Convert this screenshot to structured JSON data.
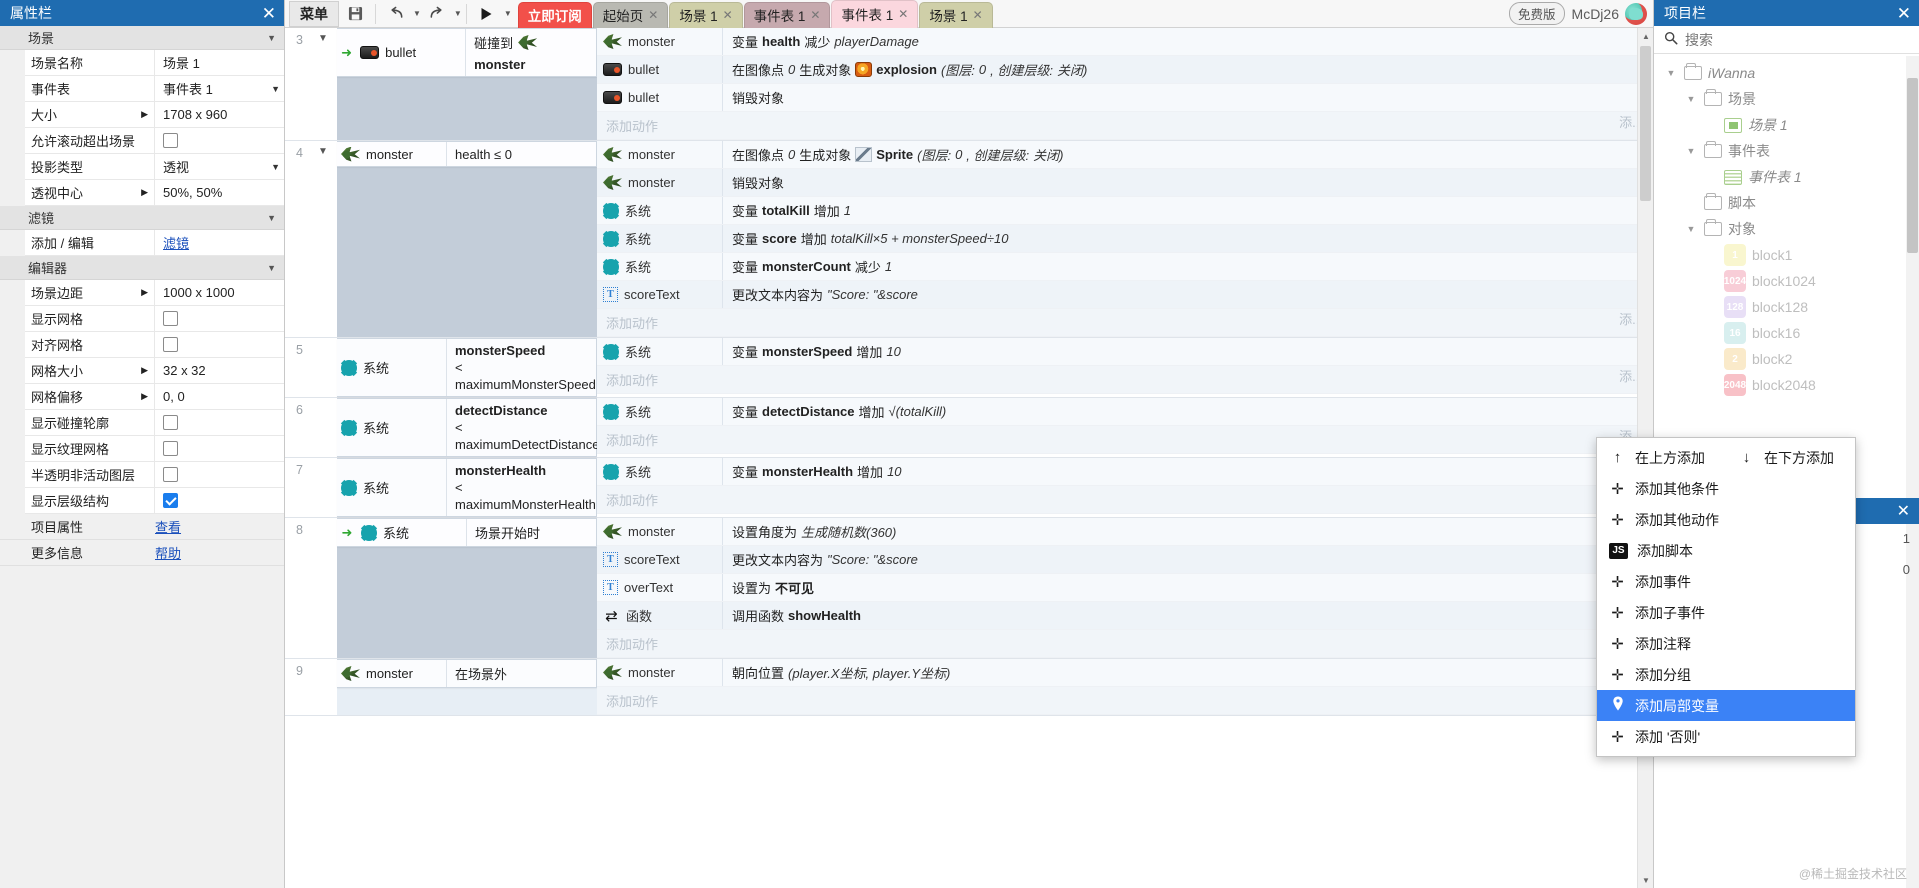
{
  "left_panel": {
    "title": "属性栏",
    "close_icon": "close-icon",
    "groups": [
      {
        "name": "场景",
        "rows": [
          {
            "label": "场景名称",
            "value": "场景 1",
            "type": "text",
            "expand": false
          },
          {
            "label": "事件表",
            "value": "事件表 1",
            "type": "select",
            "expand": false
          },
          {
            "label": "大小",
            "value": "1708 x 960",
            "type": "text",
            "expand": true
          },
          {
            "label": "允许滚动超出场景",
            "value": "",
            "type": "checkbox",
            "checked": false,
            "expand": false
          },
          {
            "label": "投影类型",
            "value": "透视",
            "type": "select",
            "expand": false
          },
          {
            "label": "透视中心",
            "value": "50%, 50%",
            "type": "text",
            "expand": true
          }
        ]
      },
      {
        "name": "滤镜",
        "rows": [
          {
            "label": "添加 / 编辑",
            "value": "滤镜",
            "type": "link",
            "expand": false
          }
        ]
      },
      {
        "name": "编辑器",
        "rows": [
          {
            "label": "场景边距",
            "value": "1000 x 1000",
            "type": "text",
            "expand": true
          },
          {
            "label": "显示网格",
            "value": "",
            "type": "checkbox",
            "checked": false,
            "expand": false
          },
          {
            "label": "对齐网格",
            "value": "",
            "type": "checkbox",
            "checked": false,
            "expand": false
          },
          {
            "label": "网格大小",
            "value": "32 x 32",
            "type": "text",
            "expand": true
          },
          {
            "label": "网格偏移",
            "value": "0, 0",
            "type": "text",
            "expand": true
          },
          {
            "label": "显示碰撞轮廓",
            "value": "",
            "type": "checkbox",
            "checked": false,
            "expand": false
          },
          {
            "label": "显示纹理网格",
            "value": "",
            "type": "checkbox",
            "checked": false,
            "expand": false
          },
          {
            "label": "半透明非活动图层",
            "value": "",
            "type": "checkbox",
            "checked": false,
            "expand": false
          },
          {
            "label": "显示层级结构",
            "value": "",
            "type": "checkbox",
            "checked": true,
            "expand": false
          }
        ]
      }
    ],
    "footer_rows": [
      {
        "label": "项目属性",
        "link": "查看"
      },
      {
        "label": "更多信息",
        "link": "帮助"
      }
    ]
  },
  "toolbar": {
    "menu_label": "菜单",
    "save_icon": "save-icon",
    "undo_icon": "undo-icon",
    "redo_icon": "redo-icon",
    "run_icon": "play-icon",
    "dropdown_icon": "chevron-down-icon",
    "subscribe_label": "立即订阅",
    "tabs": [
      {
        "label": "起始页",
        "closable": true,
        "active": false,
        "color": "#b9b9b2"
      },
      {
        "label": "场景 1",
        "closable": true,
        "active": false,
        "color": "#cfcfa8"
      },
      {
        "label": "事件表 1",
        "closable": true,
        "active": false,
        "color": "#c6a9ae"
      },
      {
        "label": "事件表 1",
        "closable": true,
        "active": true,
        "color": "#fbd7de"
      },
      {
        "label": "场景 1",
        "closable": true,
        "active": false,
        "color": "#cfcfa8"
      }
    ],
    "edition_badge": "免费版",
    "user_name": "McDj26",
    "avatar_icon": "avatar"
  },
  "event_sheet": {
    "add_action_label": "添加动作",
    "add_right_label": "添...",
    "add_right_label_full": "添加",
    "rows": [
      {
        "num": "3",
        "has_tree_arrow": true,
        "green_arrow": true,
        "cond_obj": "bullet",
        "cond_obj_icon": "bullet-icon",
        "cond_text_prefix": "碰撞到",
        "cond_text_obj": "monster",
        "cond_text_obj_icon": "monster-icon",
        "selected": true,
        "cond_bg": "dark",
        "actions": [
          {
            "obj": "monster",
            "obj_icon": "monster-icon",
            "text": "变量 health 减少 playerDamage",
            "parts": [
              {
                "t": "变量 ",
                "s": "n"
              },
              {
                "t": "health",
                "s": "b"
              },
              {
                "t": " 减少 ",
                "s": "n"
              },
              {
                "t": "playerDamage",
                "s": "i"
              }
            ]
          },
          {
            "obj": "bullet",
            "obj_icon": "bullet-icon",
            "text": "在图像点 0 生成对象 explosion (图层: 0, 创建层级: 关闭)",
            "parts": [
              {
                "t": "在图像点 ",
                "s": "n"
              },
              {
                "t": "0",
                "s": "i"
              },
              {
                "t": " 生成对象 ",
                "s": "n"
              },
              {
                "t": "__icon_explosion__",
                "s": "ic"
              },
              {
                "t": "explosion",
                "s": "b"
              },
              {
                "t": " (图层: ",
                "s": "i"
              },
              {
                "t": "0",
                "s": "i"
              },
              {
                "t": ", 创建层级: ",
                "s": "i"
              },
              {
                "t": "关闭)",
                "s": "i"
              }
            ]
          },
          {
            "obj": "bullet",
            "obj_icon": "bullet-icon",
            "text": "销毁对象",
            "parts": [
              {
                "t": "销毁对象",
                "s": "n"
              }
            ]
          }
        ]
      },
      {
        "num": "4",
        "has_tree_arrow": true,
        "green_arrow": false,
        "cond_obj": "monster",
        "cond_obj_icon": "monster-icon",
        "cond_text_prefix": "health ≤ 0",
        "cond_text_obj": "",
        "selected": true,
        "cond_bg": "dark",
        "actions": [
          {
            "obj": "monster",
            "obj_icon": "monster-icon",
            "text": "在图像点 0 生成对象 Sprite (图层: 0, 创建层级: 关闭)",
            "parts": [
              {
                "t": "在图像点 ",
                "s": "n"
              },
              {
                "t": "0",
                "s": "i"
              },
              {
                "t": " 生成对象 ",
                "s": "n"
              },
              {
                "t": "__icon_sprite__",
                "s": "ic"
              },
              {
                "t": "Sprite",
                "s": "b"
              },
              {
                "t": " (图层: ",
                "s": "i"
              },
              {
                "t": "0",
                "s": "i"
              },
              {
                "t": ", 创建层级: ",
                "s": "i"
              },
              {
                "t": "关闭)",
                "s": "i"
              }
            ]
          },
          {
            "obj": "monster",
            "obj_icon": "monster-icon",
            "text": "销毁对象",
            "parts": [
              {
                "t": "销毁对象",
                "s": "n"
              }
            ]
          },
          {
            "obj": "系统",
            "obj_icon": "system-icon",
            "text": "变量 totalKill 增加 1",
            "parts": [
              {
                "t": "变量 ",
                "s": "n"
              },
              {
                "t": "totalKill",
                "s": "b"
              },
              {
                "t": " 增加 ",
                "s": "n"
              },
              {
                "t": "1",
                "s": "i"
              }
            ]
          },
          {
            "obj": "系统",
            "obj_icon": "system-icon",
            "text": "变量 score 增加 totalKill×5 + monsterSpeed÷10",
            "parts": [
              {
                "t": "变量 ",
                "s": "n"
              },
              {
                "t": "score",
                "s": "b"
              },
              {
                "t": " 增加 ",
                "s": "n"
              },
              {
                "t": "totalKill×5 + monsterSpeed÷10",
                "s": "i"
              }
            ]
          },
          {
            "obj": "系统",
            "obj_icon": "system-icon",
            "text": "变量 monsterCount 减少 1",
            "parts": [
              {
                "t": "变量 ",
                "s": "n"
              },
              {
                "t": "monsterCount",
                "s": "b"
              },
              {
                "t": " 减少 ",
                "s": "n"
              },
              {
                "t": "1",
                "s": "i"
              }
            ]
          },
          {
            "obj": "scoreText",
            "obj_icon": "text-icon",
            "text": "更改文本内容为 \"Score: \"&score",
            "parts": [
              {
                "t": "更改文本内容为 ",
                "s": "n"
              },
              {
                "t": "\"Score: \"&score",
                "s": "i"
              }
            ]
          }
        ]
      },
      {
        "num": "5",
        "has_tree_arrow": false,
        "green_arrow": false,
        "cond_obj": "系统",
        "cond_obj_icon": "system-icon",
        "cond_text_prefix": "monsterSpeed",
        "cond_text_lines": [
          "monsterSpeed",
          "<",
          "maximumMonsterSpeed"
        ],
        "selected": false,
        "cond_bg": "light",
        "actions": [
          {
            "obj": "系统",
            "obj_icon": "system-icon",
            "text": "变量 monsterSpeed 增加 10",
            "parts": [
              {
                "t": "变量 ",
                "s": "n"
              },
              {
                "t": "monsterSpeed",
                "s": "b"
              },
              {
                "t": " 增加 ",
                "s": "n"
              },
              {
                "t": "10",
                "s": "i"
              }
            ]
          }
        ]
      },
      {
        "num": "6",
        "has_tree_arrow": false,
        "green_arrow": false,
        "cond_obj": "系统",
        "cond_obj_icon": "system-icon",
        "cond_text_lines": [
          "detectDistance",
          "<",
          "maximumDetectDistance"
        ],
        "selected": false,
        "cond_bg": "light",
        "actions": [
          {
            "obj": "系统",
            "obj_icon": "system-icon",
            "text": "变量 detectDistance 增加 √(totalKill)",
            "parts": [
              {
                "t": "变量 ",
                "s": "n"
              },
              {
                "t": "detectDistance",
                "s": "b"
              },
              {
                "t": " 增加 ",
                "s": "n"
              },
              {
                "t": "√(totalKill)",
                "s": "i"
              }
            ]
          }
        ]
      },
      {
        "num": "7",
        "has_tree_arrow": false,
        "green_arrow": false,
        "cond_obj": "系统",
        "cond_obj_icon": "system-icon",
        "cond_text_lines": [
          "monsterHealth",
          "<",
          "maximumMonsterHealth"
        ],
        "selected": false,
        "cond_bg": "light",
        "actions": [
          {
            "obj": "系统",
            "obj_icon": "system-icon",
            "text": "变量 monsterHealth 增加 10",
            "parts": [
              {
                "t": "变量 ",
                "s": "n"
              },
              {
                "t": "monsterHealth",
                "s": "b"
              },
              {
                "t": " 增加 ",
                "s": "n"
              },
              {
                "t": "10",
                "s": "i"
              }
            ]
          }
        ]
      },
      {
        "num": "8",
        "has_tree_arrow": false,
        "green_arrow": true,
        "cond_obj": "系统",
        "cond_obj_icon": "system-icon",
        "cond_text_prefix": "场景开始时",
        "selected": true,
        "cond_bg": "dark",
        "actions": [
          {
            "obj": "monster",
            "obj_icon": "monster-icon",
            "text": "设置角度为 生成随机数(360)",
            "parts": [
              {
                "t": "设置角度为 ",
                "s": "n"
              },
              {
                "t": "生成随机数(360)",
                "s": "i"
              }
            ]
          },
          {
            "obj": "scoreText",
            "obj_icon": "text-icon",
            "text": "更改文本内容为 \"Score: \"&score",
            "parts": [
              {
                "t": "更改文本内容为 ",
                "s": "n"
              },
              {
                "t": "\"Score: \"&score",
                "s": "i"
              }
            ]
          },
          {
            "obj": "overText",
            "obj_icon": "text-icon",
            "text": "设置为 不可见",
            "parts": [
              {
                "t": "设置为 ",
                "s": "n"
              },
              {
                "t": "不可见",
                "s": "b"
              }
            ]
          },
          {
            "obj": "函数",
            "obj_icon": "function-icon",
            "text": "调用函数 showHealth",
            "parts": [
              {
                "t": "调用函数 ",
                "s": "n"
              },
              {
                "t": "showHealth",
                "s": "b"
              }
            ]
          }
        ]
      },
      {
        "num": "9",
        "has_tree_arrow": false,
        "green_arrow": false,
        "cond_obj": "monster",
        "cond_obj_icon": "monster-icon",
        "cond_text_prefix": "在场景外",
        "selected": false,
        "cond_bg": "light",
        "actions": [
          {
            "obj": "monster",
            "obj_icon": "monster-icon",
            "text": "朝向位置 (player.X坐标, player.Y坐标)",
            "parts": [
              {
                "t": "朝向位置 ",
                "s": "n"
              },
              {
                "t": "(player.X坐标, player.Y坐标)",
                "s": "i"
              }
            ]
          }
        ]
      }
    ]
  },
  "context_menu": {
    "items": [
      {
        "label": "在上方添加",
        "icon": "arrow-up-icon",
        "selected": false,
        "half": true
      },
      {
        "label": "在下方添加",
        "icon": "arrow-down-icon",
        "selected": false,
        "half": true
      },
      {
        "label": "添加其他条件",
        "icon": "plus-icon",
        "selected": false
      },
      {
        "label": "添加其他动作",
        "icon": "plus-icon",
        "selected": false
      },
      {
        "label": "添加脚本",
        "icon": "js-icon",
        "selected": false
      },
      {
        "label": "添加事件",
        "icon": "plus-icon",
        "selected": false
      },
      {
        "label": "添加子事件",
        "icon": "plus-icon",
        "selected": false
      },
      {
        "label": "添加注释",
        "icon": "plus-icon",
        "selected": false
      },
      {
        "label": "添加分组",
        "icon": "plus-icon",
        "selected": false
      },
      {
        "label": "添加局部变量",
        "icon": "pin-icon",
        "selected": true
      },
      {
        "label": "添加 '否则'",
        "icon": "plus-icon",
        "selected": false
      }
    ]
  },
  "right_panel": {
    "title": "项目栏",
    "close_icon": "close-icon",
    "search_placeholder": "搜索",
    "search_value": "",
    "search_icon": "search-icon",
    "tree": [
      {
        "label": "iWanna",
        "depth": 0,
        "type": "folder",
        "expanded": true,
        "italic": true
      },
      {
        "label": "场景",
        "depth": 1,
        "type": "folder",
        "expanded": true,
        "italic": false
      },
      {
        "label": "场景 1",
        "depth": 2,
        "type": "layout",
        "expanded": null,
        "italic": true
      },
      {
        "label": "事件表",
        "depth": 1,
        "type": "folder",
        "expanded": true,
        "italic": false
      },
      {
        "label": "事件表 1",
        "depth": 2,
        "type": "sheet",
        "expanded": null,
        "italic": true
      },
      {
        "label": "脚本",
        "depth": 1,
        "type": "folder",
        "expanded": null,
        "italic": false
      },
      {
        "label": "对象",
        "depth": 1,
        "type": "folder",
        "expanded": true,
        "italic": false
      },
      {
        "label": "block1",
        "depth": 2,
        "type": "object",
        "badge": "1",
        "color": "#f5f0a8"
      },
      {
        "label": "block1024",
        "depth": 2,
        "type": "object",
        "badge": "1024",
        "color": "#f4a6b8"
      },
      {
        "label": "block128",
        "depth": 2,
        "type": "object",
        "badge": "128",
        "color": "#d6c6ef"
      },
      {
        "label": "block16",
        "depth": 2,
        "type": "object",
        "badge": "16",
        "color": "#b9e3e2"
      },
      {
        "label": "block2",
        "depth": 2,
        "type": "object",
        "badge": "2",
        "color": "#f7d9a0"
      },
      {
        "label": "block2048",
        "depth": 2,
        "type": "object",
        "badge": "2048",
        "color": "#f4909b"
      }
    ],
    "numbers": [
      "1",
      "0"
    ]
  },
  "watermark": "@稀土掘金技术社区"
}
